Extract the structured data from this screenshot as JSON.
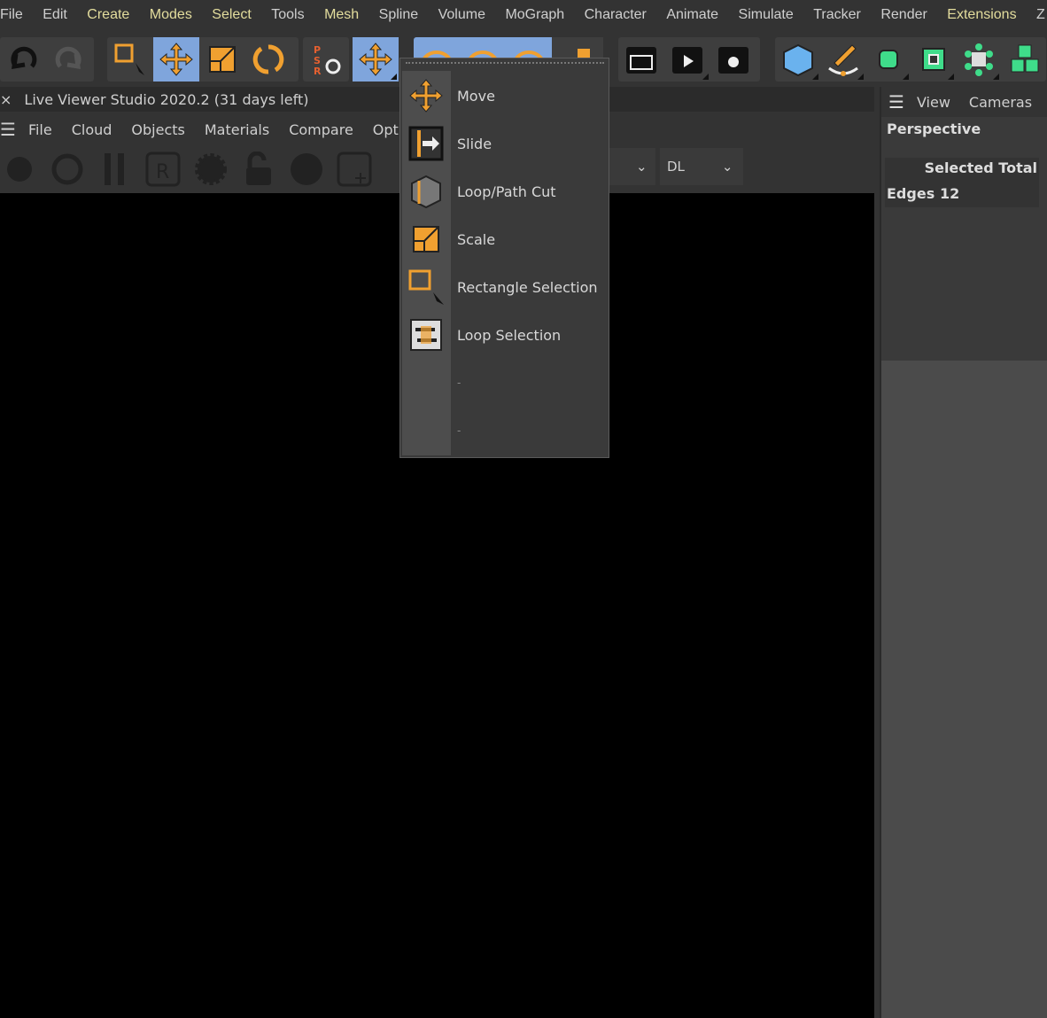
{
  "menubar": {
    "items": [
      {
        "label": "File",
        "hl": false
      },
      {
        "label": "Edit",
        "hl": false
      },
      {
        "label": "Create",
        "hl": true
      },
      {
        "label": "Modes",
        "hl": true
      },
      {
        "label": "Select",
        "hl": true
      },
      {
        "label": "Tools",
        "hl": false
      },
      {
        "label": "Mesh",
        "hl": true
      },
      {
        "label": "Spline",
        "hl": false
      },
      {
        "label": "Volume",
        "hl": false
      },
      {
        "label": "MoGraph",
        "hl": false
      },
      {
        "label": "Character",
        "hl": false
      },
      {
        "label": "Animate",
        "hl": false
      },
      {
        "label": "Simulate",
        "hl": false
      },
      {
        "label": "Tracker",
        "hl": false
      },
      {
        "label": "Render",
        "hl": false
      },
      {
        "label": "Extensions",
        "hl": true
      },
      {
        "label": "Z",
        "hl": false
      }
    ]
  },
  "colors": {
    "accent": "#f0a030",
    "active": "#7fa5dc",
    "highlight_menu": "#e3dd9d",
    "green": "#3fdc8a"
  },
  "live_viewer": {
    "close": "×",
    "title": "Live Viewer Studio 2020.2 (31 days left)",
    "menu": [
      "File",
      "Cloud",
      "Objects",
      "Materials",
      "Compare",
      "Options"
    ],
    "dropdown_value": "DL"
  },
  "right_panel": {
    "menu": [
      "View",
      "Cameras"
    ],
    "view_name": "Perspective",
    "col_header": "Selected Total",
    "row_label": "Edges",
    "row_value": "12"
  },
  "popup": {
    "items": [
      {
        "label": "Move",
        "icon": "move-icon"
      },
      {
        "label": "Slide",
        "icon": "slide-icon"
      },
      {
        "label": "Loop/Path Cut",
        "icon": "loop-path-cut-icon"
      },
      {
        "label": "Scale",
        "icon": "scale-icon"
      },
      {
        "label": "Rectangle Selection",
        "icon": "rectangle-selection-icon"
      },
      {
        "label": "Loop Selection",
        "icon": "loop-selection-icon"
      },
      {
        "label": "-",
        "icon": ""
      },
      {
        "label": "-",
        "icon": ""
      }
    ]
  }
}
